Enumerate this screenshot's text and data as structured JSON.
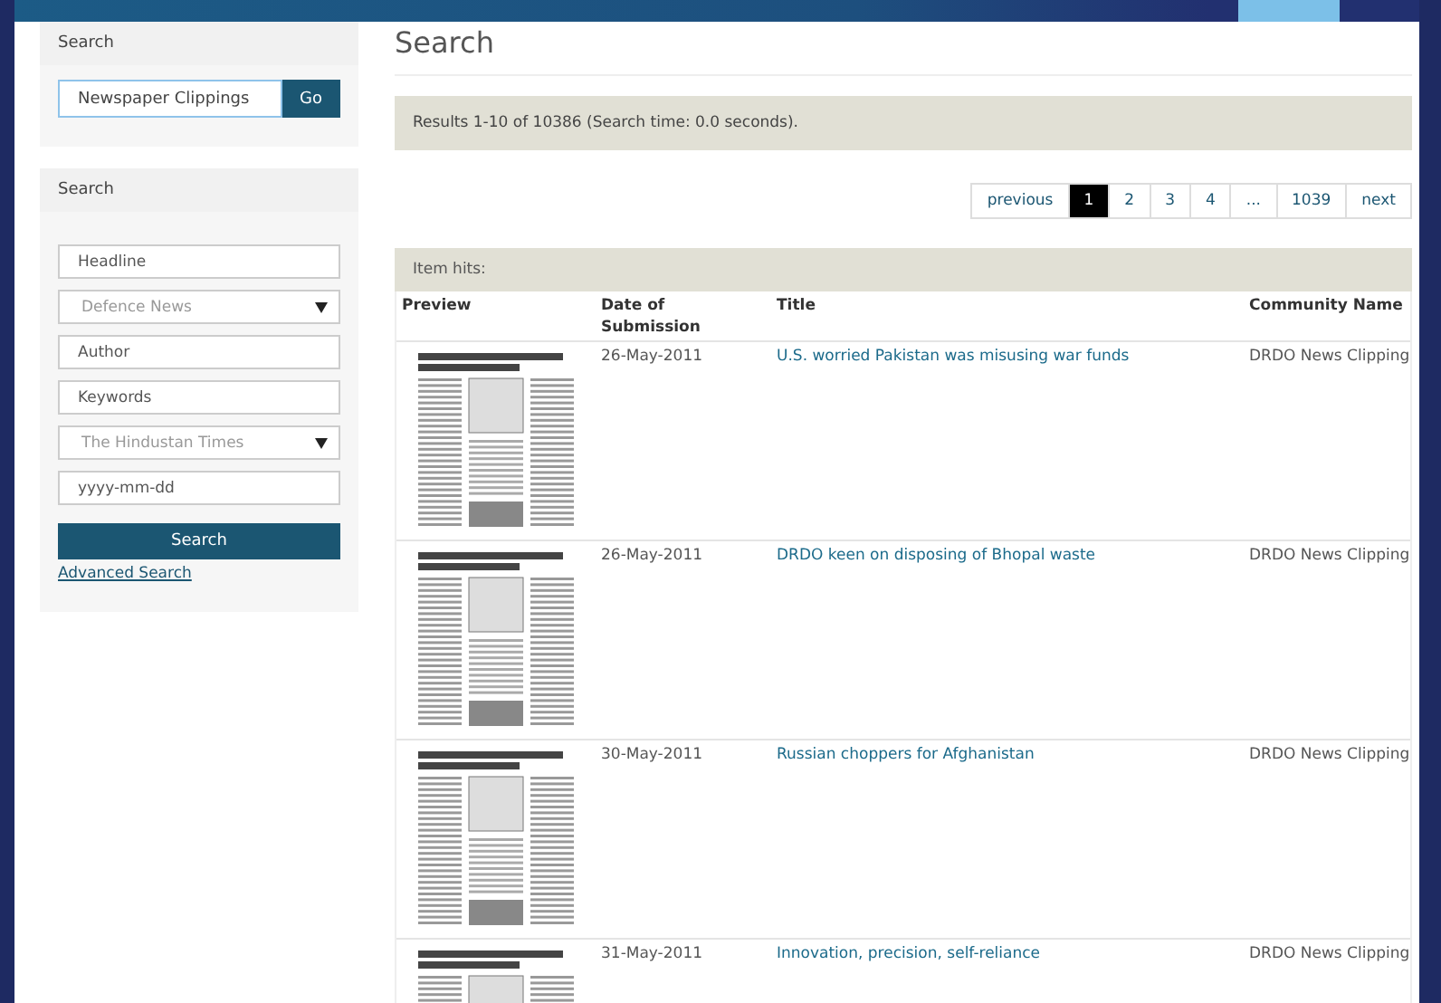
{
  "sidebar": {
    "quick_search": {
      "heading": "Search",
      "field": {
        "value": "Newspaper Clippings"
      },
      "button": "Go"
    },
    "advanced_search": {
      "heading": "Search",
      "fields": [
        {
          "kind": "text",
          "placeholder": "Headline"
        },
        {
          "kind": "select",
          "value": "Defence News"
        },
        {
          "kind": "text",
          "placeholder": "Author"
        },
        {
          "kind": "text",
          "placeholder": "Keywords"
        },
        {
          "kind": "select",
          "value": "The Hindustan Times"
        },
        {
          "kind": "text",
          "placeholder": "yyyy-mm-dd"
        }
      ],
      "button": "Search",
      "link": "Advanced Search"
    }
  },
  "main": {
    "title": "Search",
    "results_summary": "Results 1-10 of 10386 (Search time: 0.0 seconds).",
    "pagination": [
      {
        "label": "previous",
        "selected": false
      },
      {
        "label": "1",
        "selected": true
      },
      {
        "label": "2",
        "selected": false
      },
      {
        "label": "3",
        "selected": false
      },
      {
        "label": "4",
        "selected": false
      },
      {
        "label": "...",
        "selected": false
      },
      {
        "label": "1039",
        "selected": false
      },
      {
        "label": "next",
        "selected": false
      }
    ],
    "hits_heading": "Item hits:",
    "table": {
      "columns": [
        "Preview",
        "Date of Submission",
        "Title",
        "Community Name"
      ],
      "rows": [
        {
          "date": "26-May-2011",
          "title": "U.S. worried Pakistan was misusing war funds",
          "community": "DRDO News Clipping"
        },
        {
          "date": "26-May-2011",
          "title": "DRDO keen on disposing of Bhopal waste",
          "community": "DRDO News Clipping"
        },
        {
          "date": "30-May-2011",
          "title": "Russian choppers for Afghanistan",
          "community": "DRDO News Clipping"
        },
        {
          "date": "31-May-2011",
          "title": "Innovation, precision, self-reliance",
          "community": "DRDO News Clipping"
        }
      ]
    }
  }
}
